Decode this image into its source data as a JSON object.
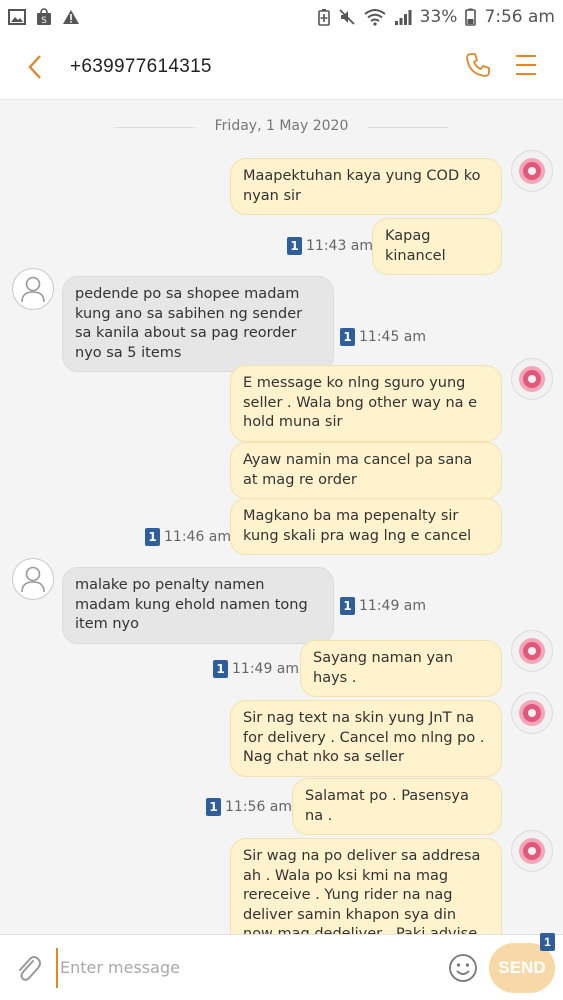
{
  "status_bar": {
    "battery": "33%",
    "time": "7:56 am",
    "icons_left": [
      "gallery-icon",
      "shopee-icon",
      "warning-icon"
    ],
    "icons_right": [
      "battery-saver-icon",
      "mute-icon",
      "wifi-icon",
      "signal-icon",
      "battery-icon"
    ]
  },
  "header": {
    "contact": "+639977614315",
    "icons": [
      "back-arrow-icon",
      "phone-icon",
      "menu-icon"
    ],
    "accent_color": "#e0892b"
  },
  "conversation": {
    "date": "Friday, 1 May 2020",
    "messages": [
      {
        "dir": "out",
        "text": "Maapektuhan kaya yung COD ko nyan sir"
      },
      {
        "dir": "out",
        "text": "Kapag kinancel",
        "sim": "1",
        "time": "11:43 am"
      },
      {
        "dir": "in",
        "text": "pedende po sa shopee madam kung ano sa sabihen ng sender sa kanila about sa pag reorder nyo sa 5 items",
        "sim": "1",
        "time": "11:45 am"
      },
      {
        "dir": "out",
        "text": "E message ko nlng sguro yung seller . Wala bng other way na e hold muna sir"
      },
      {
        "dir": "out",
        "text": "Ayaw namin ma cancel pa sana at mag re order"
      },
      {
        "dir": "out",
        "text": "Magkano ba ma pepenalty sir kung skali pra wag lng e cancel",
        "sim": "1",
        "time": "11:46 am"
      },
      {
        "dir": "in",
        "text": "malake po penalty namen madam kung ehold namen tong item nyo",
        "sim": "1",
        "time": "11:49 am"
      },
      {
        "dir": "out",
        "text": "Sayang naman yan hays .",
        "sim": "1",
        "time": "11:49 am"
      },
      {
        "dir": "out",
        "text": "Sir nag text na skin yung JnT na for delivery . Cancel mo nlng po . Nag chat  nko sa seller"
      },
      {
        "dir": "out",
        "text": "Salamat po . Pasensya na .",
        "sim": "1",
        "time": "11:56 am"
      },
      {
        "dir": "out",
        "text": "Sir wag na po deliver sa addresa ah . Wala po ksi kmi na mag rereceive . Yung rider na nag deliver samin khapon sya din now mag dedeliver . Paki advise nlng po"
      }
    ]
  },
  "input": {
    "placeholder": "Enter message",
    "send_label": "SEND",
    "sim": "1"
  }
}
